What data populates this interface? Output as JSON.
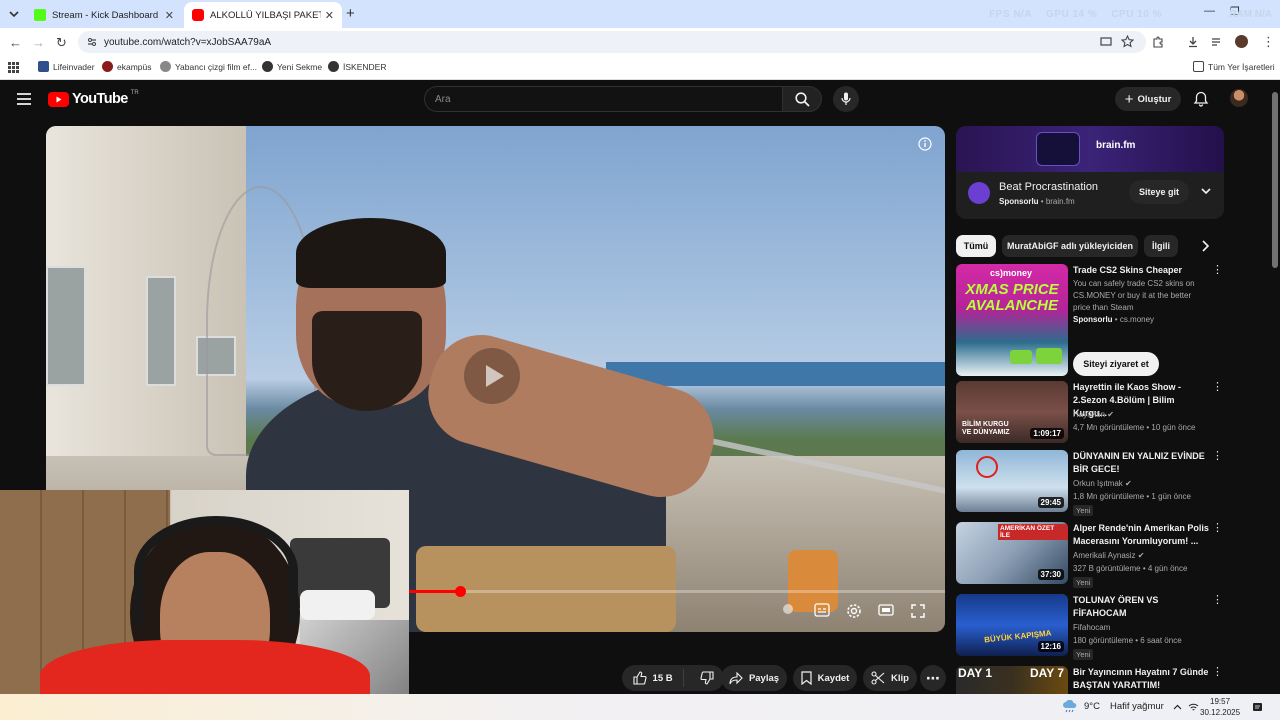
{
  "browser": {
    "tabs": [
      {
        "title": "Stream - Kick Dashboard",
        "favicon_color": "#53fc18"
      },
      {
        "title": "ALKOLLÜ YILBAŞI PAKETLERİNİ",
        "favicon_color": "#ff0000"
      }
    ],
    "perf": {
      "fps_label": "FPS",
      "fps_value": "N/A",
      "gpu_label": "GPU",
      "gpu_value": "14 %",
      "cpu_label": "CPU",
      "cpu_value": "10 %",
      "ram_label": "RAM",
      "ram_value": "N/A"
    },
    "url": "youtube.com/watch?v=xJobSAA79aA",
    "bookmarks": [
      "Lifeinvader",
      "ekampüs",
      "Yabancı çizgi film ef...",
      "Yeni Sekme",
      "İSKENDER"
    ],
    "all_bookmarks": "Tüm Yer İşaretleri"
  },
  "youtube": {
    "logo_text": "YouTube",
    "logo_region": "TR",
    "search_placeholder": "Ara",
    "create_label": "Oluştur",
    "actions": {
      "likes": "15 B",
      "share": "Paylaş",
      "save": "Kaydet",
      "clip": "Klip"
    },
    "progress": 0.46,
    "ad": {
      "brand": "brain.fm",
      "title": "Beat Procrastination",
      "sponsored": "Sponsorlu",
      "domain": "brain.fm",
      "button": "Siteye git"
    },
    "chips": [
      "Tümü",
      "MuratAbiGF adlı yükleyiciden",
      "İlgili"
    ],
    "videos": [
      {
        "title": "Trade CS2 Skins Cheaper",
        "desc": "You can safely trade CS2 skins on CS.MONEY or buy it at the better price than Steam",
        "sponsored": "Sponsorlu",
        "channel": "cs.money",
        "button": "Siteyi ziyaret et",
        "thumb_text": "XMAS PRICE AVALANCHE",
        "thumb_brand": "cs)money"
      },
      {
        "title": "Hayrettin ile Kaos Show - 2.Sezon 4.Bölüm | Bilim Kurgu...",
        "channel": "Hayrettin",
        "meta": "4,7 Mn görüntüleme • 10 gün önce",
        "duration": "1:09:17",
        "thumb_text": "BİLİM KURGU VE DÜNYAMIZ"
      },
      {
        "title": "DÜNYANIN EN YALNIZ EVİNDE BİR GECE!",
        "channel": "Orkun Işıtmak",
        "meta": "1,8 Mn görüntüleme • 1 gün önce",
        "badge": "Yeni",
        "duration": "29:45"
      },
      {
        "title": "Alper Rende'nin Amerikan Polis Macerasını Yorumluyorum! ...",
        "channel": "Amerikali Aynasiz",
        "meta": "327 B görüntüleme • 4 gün önce",
        "badge": "Yeni",
        "duration": "37:30",
        "thumb_text": "AMERİKAN ÖZET İLE"
      },
      {
        "title": "TOLUNAY ÖREN VS FİFAHOCAM",
        "channel": "Fifahocam",
        "meta": "180 görüntüleme • 6 saat önce",
        "badge": "Yeni",
        "duration": "12:16",
        "thumb_text": "BÜYÜK KAPIŞMA"
      },
      {
        "title": "Bir Yayıncının Hayatını 7 Günde BAŞTAN YARATTIM!",
        "thumb_left": "DAY 1",
        "thumb_right": "DAY 7"
      }
    ]
  },
  "taskbar": {
    "weather_temp": "9°C",
    "weather_desc": "Hafif yağmur",
    "time": "19:57",
    "date": "30.12.2025"
  }
}
